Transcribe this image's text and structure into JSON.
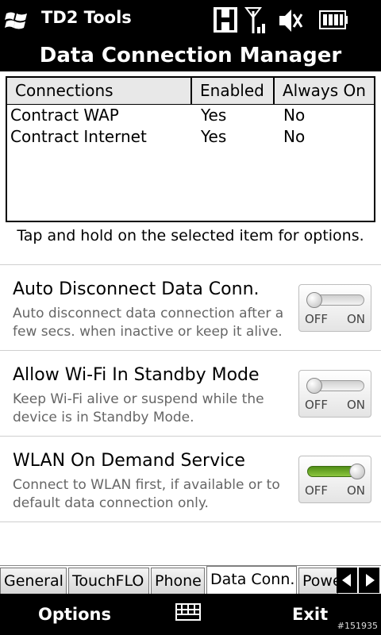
{
  "statusbar": {
    "app_title": "TD2 Tools",
    "icons": [
      "windows-logo-icon",
      "h-network-icon",
      "signal-strength-icon",
      "speaker-muted-icon",
      "battery-icon"
    ],
    "network_letter": "H"
  },
  "header": {
    "title": "Data Connection Manager"
  },
  "connections": {
    "columns": [
      "Connections",
      "Enabled",
      "Always On"
    ],
    "rows": [
      [
        "Contract WAP",
        "Yes",
        "No"
      ],
      [
        "Contract Internet",
        "Yes",
        "No"
      ]
    ]
  },
  "hint": "Tap and hold on the selected item for options.",
  "settings": [
    {
      "title": "Auto Disconnect Data Conn.",
      "description": "Auto disconnect data connection after a few secs. when inactive or keep it alive.",
      "state": "off"
    },
    {
      "title": "Allow Wi-Fi In Standby Mode",
      "description": "Keep Wi-Fi alive or suspend while the device is in Standby Mode.",
      "state": "off"
    },
    {
      "title": "WLAN On Demand Service",
      "description": "Connect to WLAN first, if available or to default data connection only.",
      "state": "on"
    }
  ],
  "toggle_labels": {
    "off": "OFF",
    "on": "ON"
  },
  "tabs": [
    "General",
    "TouchFLO",
    "Phone",
    "Data Conn.",
    "Power"
  ],
  "active_tab": "Data Conn.",
  "softkeys": {
    "left": "Options",
    "right": "Exit"
  },
  "watermark": "#151935",
  "colors": {
    "toggle_on": "#6aaa2a",
    "bars": "#000000"
  }
}
